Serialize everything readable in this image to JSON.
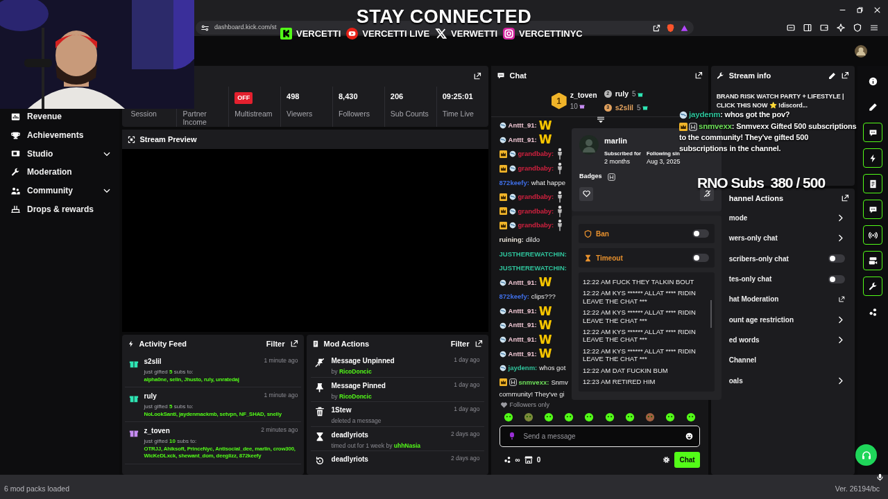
{
  "browser": {
    "address": "dashboard.kick.com/st"
  },
  "banner": {
    "title": "STAY CONNECTED",
    "socials": [
      {
        "kind": "kick",
        "handle": "VERCETTI"
      },
      {
        "kind": "youtube",
        "handle": "VERCETTI LIVE"
      },
      {
        "kind": "x",
        "handle": "VERWETTI"
      },
      {
        "kind": "instagram",
        "handle": "VERCETTINYC"
      }
    ]
  },
  "sidebar": {
    "items": [
      {
        "label": "Revenue",
        "expandable": false
      },
      {
        "label": "Achievements",
        "expandable": false
      },
      {
        "label": "Studio",
        "expandable": true
      },
      {
        "label": "Moderation",
        "expandable": false
      },
      {
        "label": "Community",
        "expandable": true
      },
      {
        "label": "Drops & rewards",
        "expandable": false
      }
    ]
  },
  "stats": [
    {
      "kind": "label",
      "label": "Session"
    },
    {
      "kind": "label",
      "label": "Partner Income"
    },
    {
      "kind": "badge",
      "badge": "OFF",
      "label": "Multistream"
    },
    {
      "kind": "value",
      "value": "498",
      "label": "Viewers"
    },
    {
      "kind": "value",
      "value": "8,430",
      "label": "Followers"
    },
    {
      "kind": "value",
      "value": "206",
      "label": "Sub Counts"
    },
    {
      "kind": "value",
      "value": "09:25:01",
      "label": "Time Live"
    }
  ],
  "stream_preview": {
    "title": "Stream Preview"
  },
  "activity_feed": {
    "title": "Activity Feed",
    "filter": "Filter",
    "items": [
      {
        "user": "s2slil",
        "time": "1 minute ago",
        "color": "#2ee6b4",
        "sentence": "just gifted **5** subs to:",
        "recipients": "alpha0ne, selin, Jhusto, ruly, unratedaj"
      },
      {
        "user": "ruly",
        "time": "1 minute ago",
        "color": "#2ee6b4",
        "sentence": "just gifted **5** subs to:",
        "recipients": "NoLookSanti, jaydenmackmb, setvpn, NF_SHAD, snelly"
      },
      {
        "user": "z_toven",
        "time": "2 minutes ago",
        "color": "#c58bf0",
        "sentence": "just gifted **10** subs to:",
        "recipients": "OTRJJ, Ahiksoft, PrinceNyc, Antisocial_dee, marlin, crow300, WicKeDLxck, shewant_dom, deeglizz, 872keefy"
      }
    ]
  },
  "mod_actions": {
    "title": "Mod Actions",
    "filter": "Filter",
    "items": [
      {
        "kind": "unpin",
        "title": "Message Unpinned",
        "time": "1 day ago",
        "detail": "by",
        "by": "RicoDoncic"
      },
      {
        "kind": "pin",
        "title": "Message Pinned",
        "time": "1 day ago",
        "detail": "by",
        "by": "RicoDoncic"
      },
      {
        "kind": "delete",
        "title": "1Stew",
        "time": "1 day ago",
        "detail": "deleted a message"
      },
      {
        "kind": "timeout",
        "title": "deadlyriots",
        "time": "2 days ago",
        "detail": "timed out for 1 week by",
        "by": "uhhNasia"
      },
      {
        "kind": "unban",
        "title": "deadlyriots",
        "time": "2 days ago"
      }
    ]
  },
  "chat": {
    "title": "Chat",
    "leaderboard": [
      {
        "rank": "1",
        "user": "z_toven",
        "count": "10",
        "color": "#c58bf0"
      },
      {
        "rank": "2",
        "user": "ruly",
        "count": "5",
        "color": "#2ee6b4"
      },
      {
        "rank": "3",
        "user": "s2slil",
        "count": "5",
        "color": "#2ee6b4"
      }
    ],
    "messages": [
      {
        "kind": "letter_emote",
        "crown": false,
        "h_badge": false,
        "globe": true,
        "user": "Anttt_91:",
        "color": "#f3c9d6",
        "emote": "W"
      },
      {
        "kind": "letter_emote",
        "crown": false,
        "h_badge": false,
        "globe": true,
        "user": "Anttt_91:",
        "color": "#f3c9d6",
        "emote": "W"
      },
      {
        "kind": "figure_emote",
        "crown": true,
        "h_badge": false,
        "globe": true,
        "user": "grandbaby:",
        "color": "#d3213f"
      },
      {
        "kind": "figure_emote",
        "crown": true,
        "h_badge": false,
        "globe": true,
        "user": "grandbaby:",
        "color": "#d3213f"
      },
      {
        "kind": "text",
        "crown": false,
        "h_badge": false,
        "globe": false,
        "user": "872keefy:",
        "color": "#3f6fe8",
        "text": "what happe"
      },
      {
        "kind": "figure_emote",
        "crown": true,
        "h_badge": false,
        "globe": true,
        "user": "grandbaby:",
        "color": "#d3213f"
      },
      {
        "kind": "figure_emote",
        "crown": true,
        "h_badge": false,
        "globe": true,
        "user": "grandbaby:",
        "color": "#d3213f"
      },
      {
        "kind": "figure_emote",
        "crown": true,
        "h_badge": false,
        "globe": true,
        "user": "grandbaby:",
        "color": "#d3213f"
      },
      {
        "kind": "text",
        "crown": false,
        "h_badge": false,
        "globe": false,
        "user": "ruining:",
        "color": "#e6e0d6",
        "text": "dildo"
      },
      {
        "kind": "text",
        "crown": false,
        "h_badge": false,
        "globe": false,
        "user": "JUSTHEREWATCHIN:",
        "color": "#2fc49c"
      },
      {
        "kind": "text",
        "crown": false,
        "h_badge": false,
        "globe": false,
        "user": "JUSTHEREWATCHIN:",
        "color": "#2fc49c"
      },
      {
        "kind": "letter_emote",
        "crown": false,
        "h_badge": false,
        "globe": true,
        "user": "Anttt_91:",
        "color": "#f3c9d6",
        "emote": "W"
      },
      {
        "kind": "text",
        "crown": false,
        "h_badge": false,
        "globe": false,
        "user": "872keefy:",
        "color": "#3f6fe8",
        "text": "clips???"
      },
      {
        "kind": "letter_emote",
        "crown": false,
        "h_badge": false,
        "globe": true,
        "user": "Anttt_91:",
        "color": "#f3c9d6",
        "emote": "W"
      },
      {
        "kind": "letter_emote",
        "crown": false,
        "h_badge": false,
        "globe": true,
        "user": "Anttt_91:",
        "color": "#f3c9d6",
        "emote": "W"
      },
      {
        "kind": "letter_emote",
        "crown": false,
        "h_badge": false,
        "globe": true,
        "user": "Anttt_91:",
        "color": "#f3c9d6",
        "emote": "W"
      },
      {
        "kind": "letter_emote",
        "crown": false,
        "h_badge": false,
        "globe": true,
        "user": "Anttt_91:",
        "color": "#f3c9d6",
        "emote": "W"
      },
      {
        "kind": "text",
        "crown": false,
        "h_badge": false,
        "globe": true,
        "user": "jaydenm:",
        "color": "#2fc49c",
        "text": "whos got"
      },
      {
        "kind": "text",
        "crown": true,
        "h_badge": true,
        "globe": false,
        "user": "snmvexx:",
        "color": "#6fe05a",
        "text": "Snmv",
        "wrap": "community! They've gi"
      }
    ],
    "followers_only": "Followers only",
    "placeholder": "Send a message",
    "infinite": "∞",
    "points": "0",
    "send": "Chat"
  },
  "user_card": {
    "name": "marlin",
    "subscribed_label": "Subscribed for",
    "subscribed": "2 months",
    "following_label": "Following sin",
    "following": "Aug 3, 2025",
    "badges_label": "Badges",
    "ban": {
      "label": "Ban",
      "on": false
    },
    "timeout": {
      "label": "Timeout",
      "on": false
    },
    "log": [
      "12:22 AM FUCK THEY TALKIN BOUT",
      "12:22 AM KYS ****** ALLAT **** RIDIN LEAVE THE CHAT ***",
      "12:22 AM KYS ****** ALLAT **** RIDIN LEAVE THE CHAT ***",
      "12:22 AM KYS ****** ALLAT **** RIDIN LEAVE THE CHAT ***",
      "12:22 AM KYS ****** ALLAT **** RIDIN LEAVE THE CHAT ***",
      "12:22 AM DAT FUCKIN BUM",
      "12:23 AM RETIRED HIM"
    ]
  },
  "stream_info": {
    "title": "Stream info",
    "description": "BRAND RISK WATCH PARTY + LIFESTYLE | CLICK THIS NOW ⭐ !discord..."
  },
  "channel_actions": {
    "title": "hannel Actions",
    "items": [
      {
        "kind": "link",
        "label": "mode"
      },
      {
        "kind": "link",
        "label": "wers-only chat"
      },
      {
        "kind": "toggle",
        "label": "scribers-only chat",
        "on": false
      },
      {
        "kind": "toggle",
        "label": "tes-only chat",
        "on": false
      },
      {
        "kind": "external",
        "label": "hat Moderation"
      },
      {
        "kind": "link",
        "label": "ount age restriction"
      },
      {
        "kind": "link",
        "label": "ed words"
      },
      {
        "kind": "plain",
        "label": "Channel"
      },
      {
        "kind": "link",
        "label": "oals"
      }
    ]
  },
  "overlay_chat": [
    {
      "crown": false,
      "h_badge": false,
      "globe": true,
      "user": "jaydenm",
      "color": "#2fc49c",
      "text": ": whos got the pov?"
    },
    {
      "crown": true,
      "h_badge": true,
      "globe": false,
      "user": "snmvexx",
      "color": "#6fe05a",
      "text": ": Snmvexx Gifted 500 subscriptions to the community! They've gifted 500 subscriptions in the channel."
    }
  ],
  "sub_goal": "RNO Subs  380 / 500",
  "rail": [
    {
      "on": false
    },
    {
      "on": false
    },
    {
      "on": true
    },
    {
      "on": true
    },
    {
      "on": true
    },
    {
      "on": true
    },
    {
      "on": true
    },
    {
      "on": true
    },
    {
      "on": true
    },
    {
      "on": false
    }
  ],
  "status_bar": {
    "left": "6 mod packs loaded",
    "right": "Ver. 26194/bc"
  }
}
